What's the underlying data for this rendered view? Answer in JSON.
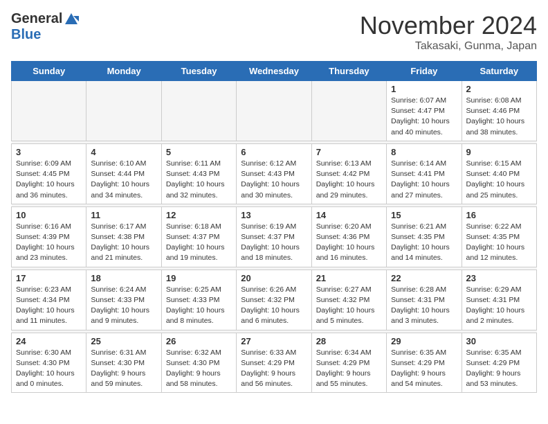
{
  "logo": {
    "general": "General",
    "blue": "Blue"
  },
  "title": "November 2024",
  "location": "Takasaki, Gunma, Japan",
  "days_of_week": [
    "Sunday",
    "Monday",
    "Tuesday",
    "Wednesday",
    "Thursday",
    "Friday",
    "Saturday"
  ],
  "weeks": [
    [
      {
        "day": "",
        "info": ""
      },
      {
        "day": "",
        "info": ""
      },
      {
        "day": "",
        "info": ""
      },
      {
        "day": "",
        "info": ""
      },
      {
        "day": "",
        "info": ""
      },
      {
        "day": "1",
        "info": "Sunrise: 6:07 AM\nSunset: 4:47 PM\nDaylight: 10 hours\nand 40 minutes."
      },
      {
        "day": "2",
        "info": "Sunrise: 6:08 AM\nSunset: 4:46 PM\nDaylight: 10 hours\nand 38 minutes."
      }
    ],
    [
      {
        "day": "3",
        "info": "Sunrise: 6:09 AM\nSunset: 4:45 PM\nDaylight: 10 hours\nand 36 minutes."
      },
      {
        "day": "4",
        "info": "Sunrise: 6:10 AM\nSunset: 4:44 PM\nDaylight: 10 hours\nand 34 minutes."
      },
      {
        "day": "5",
        "info": "Sunrise: 6:11 AM\nSunset: 4:43 PM\nDaylight: 10 hours\nand 32 minutes."
      },
      {
        "day": "6",
        "info": "Sunrise: 6:12 AM\nSunset: 4:43 PM\nDaylight: 10 hours\nand 30 minutes."
      },
      {
        "day": "7",
        "info": "Sunrise: 6:13 AM\nSunset: 4:42 PM\nDaylight: 10 hours\nand 29 minutes."
      },
      {
        "day": "8",
        "info": "Sunrise: 6:14 AM\nSunset: 4:41 PM\nDaylight: 10 hours\nand 27 minutes."
      },
      {
        "day": "9",
        "info": "Sunrise: 6:15 AM\nSunset: 4:40 PM\nDaylight: 10 hours\nand 25 minutes."
      }
    ],
    [
      {
        "day": "10",
        "info": "Sunrise: 6:16 AM\nSunset: 4:39 PM\nDaylight: 10 hours\nand 23 minutes."
      },
      {
        "day": "11",
        "info": "Sunrise: 6:17 AM\nSunset: 4:38 PM\nDaylight: 10 hours\nand 21 minutes."
      },
      {
        "day": "12",
        "info": "Sunrise: 6:18 AM\nSunset: 4:37 PM\nDaylight: 10 hours\nand 19 minutes."
      },
      {
        "day": "13",
        "info": "Sunrise: 6:19 AM\nSunset: 4:37 PM\nDaylight: 10 hours\nand 18 minutes."
      },
      {
        "day": "14",
        "info": "Sunrise: 6:20 AM\nSunset: 4:36 PM\nDaylight: 10 hours\nand 16 minutes."
      },
      {
        "day": "15",
        "info": "Sunrise: 6:21 AM\nSunset: 4:35 PM\nDaylight: 10 hours\nand 14 minutes."
      },
      {
        "day": "16",
        "info": "Sunrise: 6:22 AM\nSunset: 4:35 PM\nDaylight: 10 hours\nand 12 minutes."
      }
    ],
    [
      {
        "day": "17",
        "info": "Sunrise: 6:23 AM\nSunset: 4:34 PM\nDaylight: 10 hours\nand 11 minutes."
      },
      {
        "day": "18",
        "info": "Sunrise: 6:24 AM\nSunset: 4:33 PM\nDaylight: 10 hours\nand 9 minutes."
      },
      {
        "day": "19",
        "info": "Sunrise: 6:25 AM\nSunset: 4:33 PM\nDaylight: 10 hours\nand 8 minutes."
      },
      {
        "day": "20",
        "info": "Sunrise: 6:26 AM\nSunset: 4:32 PM\nDaylight: 10 hours\nand 6 minutes."
      },
      {
        "day": "21",
        "info": "Sunrise: 6:27 AM\nSunset: 4:32 PM\nDaylight: 10 hours\nand 5 minutes."
      },
      {
        "day": "22",
        "info": "Sunrise: 6:28 AM\nSunset: 4:31 PM\nDaylight: 10 hours\nand 3 minutes."
      },
      {
        "day": "23",
        "info": "Sunrise: 6:29 AM\nSunset: 4:31 PM\nDaylight: 10 hours\nand 2 minutes."
      }
    ],
    [
      {
        "day": "24",
        "info": "Sunrise: 6:30 AM\nSunset: 4:30 PM\nDaylight: 10 hours\nand 0 minutes."
      },
      {
        "day": "25",
        "info": "Sunrise: 6:31 AM\nSunset: 4:30 PM\nDaylight: 9 hours\nand 59 minutes."
      },
      {
        "day": "26",
        "info": "Sunrise: 6:32 AM\nSunset: 4:30 PM\nDaylight: 9 hours\nand 58 minutes."
      },
      {
        "day": "27",
        "info": "Sunrise: 6:33 AM\nSunset: 4:29 PM\nDaylight: 9 hours\nand 56 minutes."
      },
      {
        "day": "28",
        "info": "Sunrise: 6:34 AM\nSunset: 4:29 PM\nDaylight: 9 hours\nand 55 minutes."
      },
      {
        "day": "29",
        "info": "Sunrise: 6:35 AM\nSunset: 4:29 PM\nDaylight: 9 hours\nand 54 minutes."
      },
      {
        "day": "30",
        "info": "Sunrise: 6:35 AM\nSunset: 4:29 PM\nDaylight: 9 hours\nand 53 minutes."
      }
    ]
  ]
}
